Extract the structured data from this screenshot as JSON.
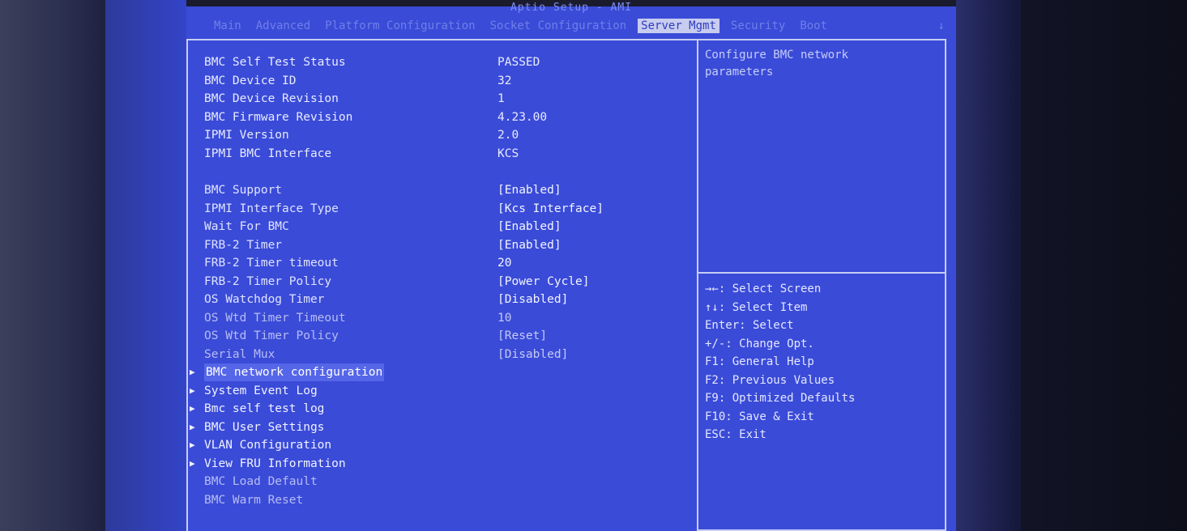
{
  "title": "Aptio Setup - AMI",
  "menu": {
    "tabs": [
      {
        "label": "Main"
      },
      {
        "label": "Advanced"
      },
      {
        "label": "Platform Configuration"
      },
      {
        "label": "Socket Configuration"
      },
      {
        "label": "Server Mgmt"
      },
      {
        "label": "Security"
      },
      {
        "label": "Boot"
      }
    ],
    "active_index": 4,
    "more": "↓"
  },
  "info": [
    {
      "label": "BMC Self Test Status",
      "value": "PASSED"
    },
    {
      "label": "BMC Device ID",
      "value": "32"
    },
    {
      "label": "BMC Device Revision",
      "value": "1"
    },
    {
      "label": "BMC Firmware Revision",
      "value": "4.23.00"
    },
    {
      "label": "IPMI Version",
      "value": "2.0"
    },
    {
      "label": "IPMI BMC Interface",
      "value": "KCS"
    }
  ],
  "settings": [
    {
      "label": "BMC Support",
      "value": "[Enabled]"
    },
    {
      "label": "IPMI Interface Type",
      "value": "[Kcs Interface]"
    },
    {
      "label": "Wait For BMC",
      "value": "[Enabled]"
    },
    {
      "label": "FRB-2 Timer",
      "value": "[Enabled]"
    },
    {
      "label": "FRB-2 Timer timeout",
      "value": "20"
    },
    {
      "label": "FRB-2 Timer Policy",
      "value": "[Power Cycle]"
    },
    {
      "label": "OS Watchdog Timer",
      "value": "[Disabled]"
    },
    {
      "label": "OS Wtd Timer Timeout",
      "value": "10"
    },
    {
      "label": "OS Wtd Timer Policy",
      "value": "[Reset]"
    },
    {
      "label": "Serial Mux",
      "value": "[Disabled]"
    }
  ],
  "submenus": [
    {
      "label": "BMC network configuration"
    },
    {
      "label": "System Event Log"
    },
    {
      "label": "Bmc self test log"
    },
    {
      "label": "BMC User Settings"
    },
    {
      "label": "VLAN Configuration"
    },
    {
      "label": "View FRU Information"
    }
  ],
  "actions": [
    {
      "label": "BMC Load Default"
    },
    {
      "label": "BMC Warm Reset"
    }
  ],
  "help": {
    "line1": "Configure BMC network",
    "line2": "parameters"
  },
  "keys": [
    "→←: Select Screen",
    "↑↓: Select Item",
    "Enter: Select",
    "+/-: Change Opt.",
    "F1: General Help",
    "F2: Previous Values",
    "F9: Optimized Defaults",
    "F10: Save & Exit",
    "ESC: Exit"
  ],
  "colors": {
    "screen_bg": "#3a4bd8",
    "active_tab_bg": "#c8ccef",
    "border": "#c7cdf4"
  }
}
